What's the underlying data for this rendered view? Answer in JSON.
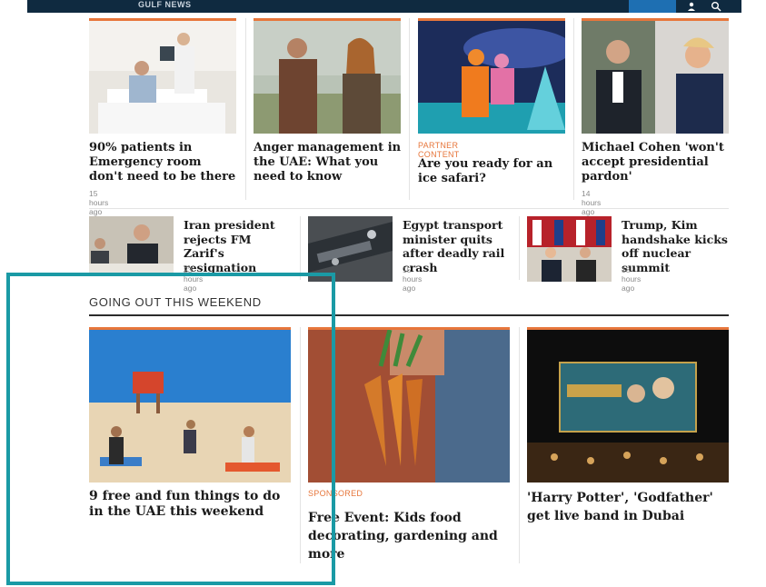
{
  "header": {
    "brand": "GULF NEWS"
  },
  "top_row": [
    {
      "headline": "90% patients in Emergency room don't need to be there",
      "time": "15 hours ago"
    },
    {
      "headline": "Anger management in the UAE: What you need to know",
      "time": ""
    },
    {
      "kicker": "PARTNER CONTENT",
      "headline": "Are you ready for an ice safari?",
      "time": ""
    },
    {
      "headline": "Michael Cohen 'won't accept presidential pardon'",
      "time": "14 hours ago"
    }
  ],
  "middle_row": [
    {
      "headline": "Iran president rejects FM Zarif's resignation",
      "time": "23 hours ago"
    },
    {
      "headline": "Egypt transport minister quits after deadly rail crash",
      "time": "15 hours ago"
    },
    {
      "headline": "Trump, Kim handshake kicks off nuclear summit",
      "time": "18 hours ago"
    }
  ],
  "section": {
    "title": "GOING OUT THIS WEEKEND"
  },
  "weekend": [
    {
      "headline": "9 free and fun things to do in the UAE this weekend"
    },
    {
      "kicker": "SPONSORED",
      "headline": "Free Event: Kids food decorating, gardening and more"
    },
    {
      "headline": "'Harry Potter', 'Godfather' get live band in Dubai"
    }
  ],
  "colors": {
    "accent": "#e7763b",
    "highlight_box": "#1a9aa5",
    "nav": "#0f2a40"
  }
}
